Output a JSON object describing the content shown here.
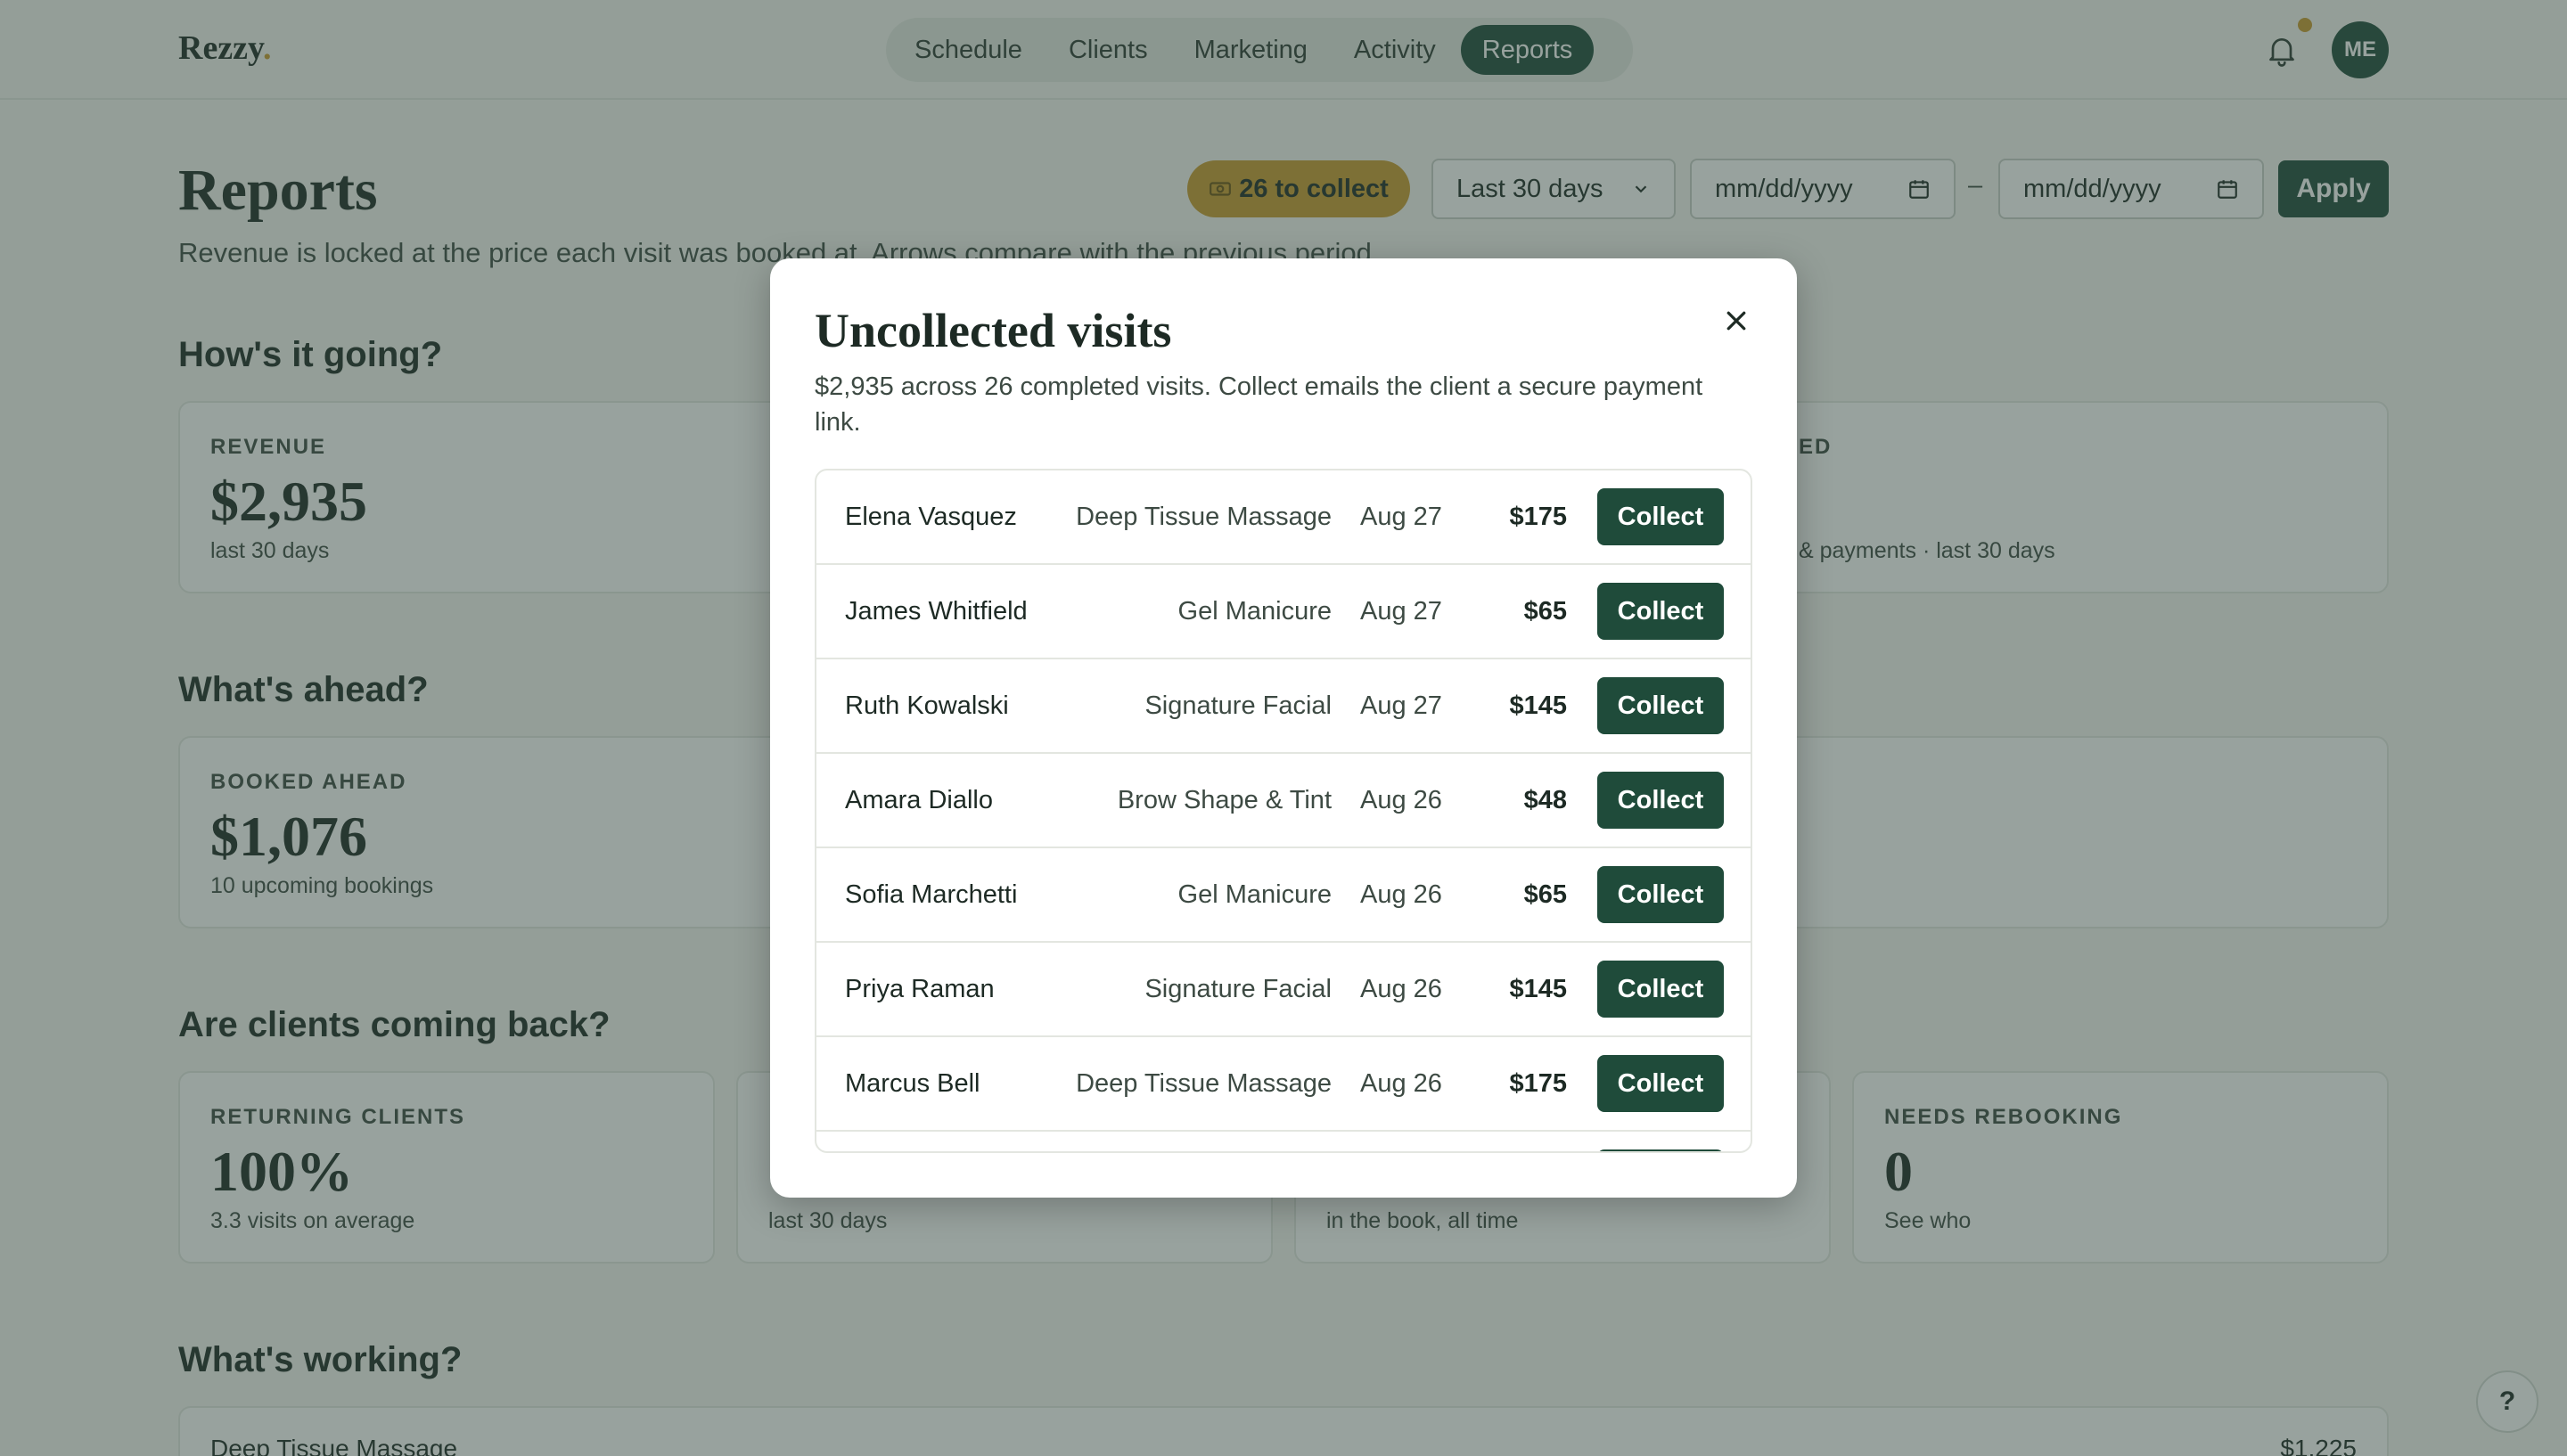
{
  "brand": {
    "name": "Rezzy",
    "dot": "."
  },
  "nav": {
    "items": [
      {
        "label": "Schedule",
        "active": false
      },
      {
        "label": "Clients",
        "active": false
      },
      {
        "label": "Marketing",
        "active": false
      },
      {
        "label": "Activity",
        "active": false
      },
      {
        "label": "Reports",
        "active": true
      }
    ]
  },
  "header": {
    "avatar_initials": "ME",
    "bell_icon": "bell-icon"
  },
  "page": {
    "title": "Reports",
    "subtitle": "Revenue is locked at the price each visit was booked at. Arrows compare with the previous period.",
    "collect_pill": "26 to collect",
    "collect_icon": "cash-icon",
    "range_select": "Last 30 days",
    "date_from_placeholder": "mm/dd/yyyy",
    "date_to_placeholder": "mm/dd/yyyy",
    "date_separator": "–",
    "apply_label": "Apply"
  },
  "sections": {
    "going": {
      "title": "How's it going?",
      "revenue": {
        "label": "REVENUE",
        "value": "$2,935",
        "note": "last 30 days"
      },
      "partial_label": "ED",
      "partial_note": "& payments · last 30 days"
    },
    "ahead": {
      "title": "What's ahead?",
      "booked": {
        "label": "BOOKED AHEAD",
        "value": "$1,076",
        "note": "10 upcoming bookings"
      }
    },
    "back": {
      "title": "Are clients coming back?",
      "returning": {
        "label": "RETURNING CLIENTS",
        "value": "100%",
        "note": "3.3 visits on average"
      },
      "card2_note": "last 30 days",
      "card3_note": "in the book, all time",
      "rebooking": {
        "label": "NEEDS REBOOKING",
        "value": "0",
        "note": "See who"
      }
    },
    "working": {
      "title": "What's working?",
      "rows": [
        {
          "name": "Deep Tissue Massage",
          "amount": "$1,225"
        }
      ]
    }
  },
  "help": {
    "label": "?"
  },
  "modal": {
    "title": "Uncollected visits",
    "description": "$2,935 across 26 completed visits. Collect emails the client a secure payment link.",
    "close_icon": "close-icon",
    "collect_label": "Collect",
    "visits": [
      {
        "name": "Elena Vasquez",
        "service": "Deep Tissue Massage",
        "date": "Aug 27",
        "amount": "$175"
      },
      {
        "name": "James Whitfield",
        "service": "Gel Manicure",
        "date": "Aug 27",
        "amount": "$65"
      },
      {
        "name": "Ruth Kowalski",
        "service": "Signature Facial",
        "date": "Aug 27",
        "amount": "$145"
      },
      {
        "name": "Amara Diallo",
        "service": "Brow Shape & Tint",
        "date": "Aug 26",
        "amount": "$48"
      },
      {
        "name": "Sofia Marchetti",
        "service": "Gel Manicure",
        "date": "Aug 26",
        "amount": "$65"
      },
      {
        "name": "Priya Raman",
        "service": "Signature Facial",
        "date": "Aug 26",
        "amount": "$145"
      },
      {
        "name": "Marcus Bell",
        "service": "Deep Tissue Massage",
        "date": "Aug 26",
        "amount": "$175"
      }
    ]
  },
  "colors": {
    "primary": "#1f4b3a",
    "accent": "#c99a2e",
    "background": "#f6f7f3",
    "overlay": "rgba(50, 70, 62, 0.5)"
  }
}
